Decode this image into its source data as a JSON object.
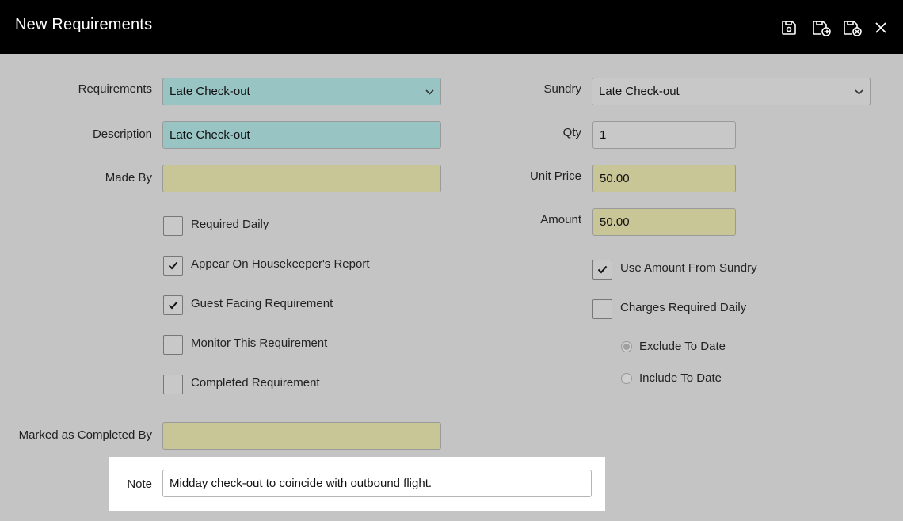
{
  "window": {
    "title": "New Requirements",
    "icons": [
      "save-icon",
      "save-and-new-icon",
      "save-and-close-icon",
      "close-icon"
    ]
  },
  "left": {
    "requirements": {
      "label": "Requirements",
      "value": "Late Check-out"
    },
    "description": {
      "label": "Description",
      "value": "Late Check-out"
    },
    "made_by": {
      "label": "Made By",
      "value": ""
    },
    "checkboxes": [
      {
        "label": "Required Daily",
        "checked": false
      },
      {
        "label": "Appear On Housekeeper's Report",
        "checked": true
      },
      {
        "label": "Guest Facing Requirement",
        "checked": true
      },
      {
        "label": "Monitor This Requirement",
        "checked": false
      },
      {
        "label": "Completed Requirement",
        "checked": false
      }
    ],
    "marked_completed_by": {
      "label": "Marked as Completed By",
      "value": ""
    },
    "note": {
      "label": "Note",
      "value": "Midday check-out to coincide with outbound flight."
    }
  },
  "right": {
    "sundry": {
      "label": "Sundry",
      "value": "Late Check-out"
    },
    "qty": {
      "label": "Qty",
      "value": "1"
    },
    "unit_price": {
      "label": "Unit Price",
      "value": "50.00"
    },
    "amount": {
      "label": "Amount",
      "value": "50.00"
    },
    "checkboxes": [
      {
        "label": "Use Amount From Sundry",
        "checked": true
      },
      {
        "label": "Charges Required Daily",
        "checked": false
      }
    ],
    "radios": [
      {
        "label": "Exclude To Date",
        "selected": true
      },
      {
        "label": "Include To Date",
        "selected": false
      }
    ]
  },
  "colors": {
    "header": "#000000",
    "background": "#c4c4c4",
    "teal_field": "#98c4c4",
    "khaki_field": "#c8c596"
  }
}
